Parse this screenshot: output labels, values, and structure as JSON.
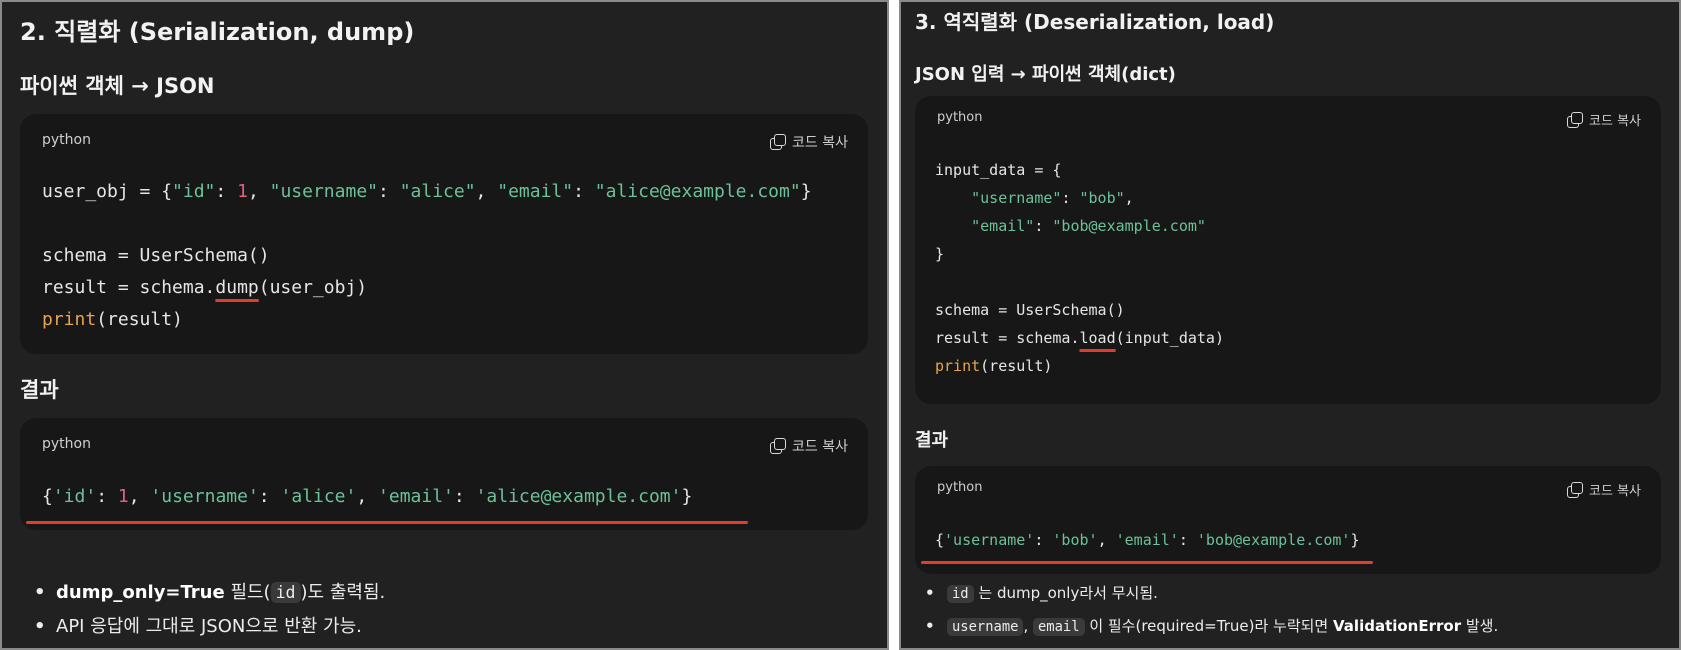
{
  "left": {
    "title": "2. 직렬화 (Serialization, dump)",
    "subtitle": "파이썬 객체 → JSON",
    "code1": {
      "lang": "python",
      "copy": "코드 복사",
      "line1": {
        "a": "user_obj = {",
        "s1": "\"id\"",
        "c1": ": ",
        "n1": "1",
        "c2": ", ",
        "s2": "\"username\"",
        "c3": ": ",
        "s3": "\"alice\"",
        "c4": ", ",
        "s4": "\"email\"",
        "c5": ": ",
        "s5": "\"alice@example.com\"",
        "c6": "}"
      },
      "line2": "schema = UserSchema()",
      "line3": {
        "a": "result = schema.",
        "m": "dump",
        "b": "(user_obj)"
      },
      "line4": {
        "f": "print",
        "b": "(result)"
      }
    },
    "result_heading": "결과",
    "code2": {
      "lang": "python",
      "copy": "코드 복사",
      "line1": {
        "a": "{",
        "s1": "'id'",
        "c1": ": ",
        "n1": "1",
        "c2": ", ",
        "s2": "'username'",
        "c3": ": ",
        "s3": "'alice'",
        "c4": ", ",
        "s4": "'email'",
        "c5": ": ",
        "s5": "'alice@example.com'",
        "c6": "}"
      }
    },
    "bullets": {
      "b1": {
        "bold": "dump_only=True",
        "t1": " 필드(",
        "code": "id",
        "t2": ")도 출력됨."
      },
      "b2": {
        "text": "API 응답에 그대로 JSON으로 반환 가능."
      }
    }
  },
  "right": {
    "title": "3. 역직렬화 (Deserialization, load)",
    "subtitle": "JSON 입력 → 파이썬 객체(dict)",
    "code1": {
      "lang": "python",
      "copy": "코드 복사",
      "line1": "input_data = {",
      "line2": {
        "s1": "\"username\"",
        "c1": ": ",
        "s2": "\"bob\"",
        "c2": ","
      },
      "line3": {
        "s1": "\"email\"",
        "c1": ": ",
        "s2": "\"bob@example.com\""
      },
      "line4": "}",
      "line5": "schema = UserSchema()",
      "line6": {
        "a": "result = schema.",
        "m": "load",
        "b": "(input_data)"
      },
      "line7": {
        "f": "print",
        "b": "(result)"
      }
    },
    "result_heading": "결과",
    "code2": {
      "lang": "python",
      "copy": "코드 복사",
      "line1": {
        "a": "{",
        "s1": "'username'",
        "c1": ": ",
        "s2": "'bob'",
        "c2": ", ",
        "s3": "'email'",
        "c3": ": ",
        "s4": "'bob@example.com'",
        "c4": "}"
      }
    },
    "bullets": {
      "b1": {
        "code": "id",
        "t1": " 는 dump_only라서 무시됨."
      },
      "b2": {
        "code1": "username",
        "sep": ", ",
        "code2": "email",
        "t1": " 이 필수(required=True)라 누락되면 ",
        "bold": "ValidationError",
        "t2": " 발생."
      }
    }
  },
  "colors": {
    "background": "#212121",
    "code_bg": "#171717",
    "string": "#6cc19a",
    "number": "#e0607e",
    "builtin": "#e8a34e",
    "underline": "#e03d2f"
  }
}
